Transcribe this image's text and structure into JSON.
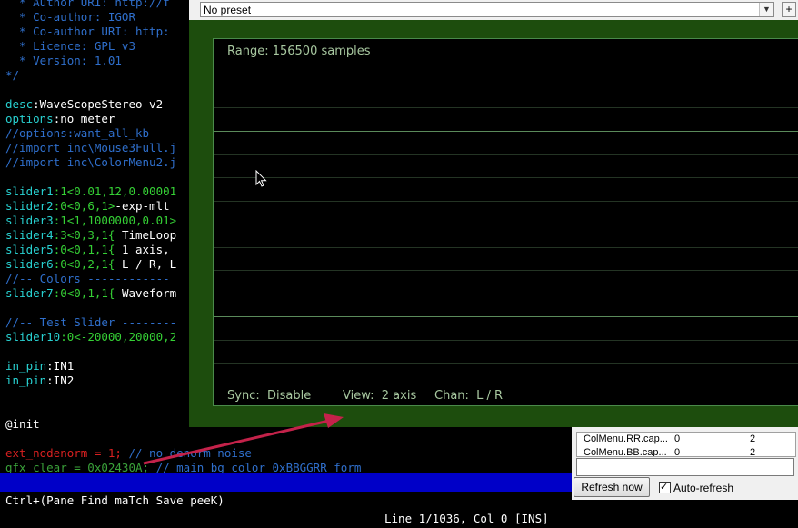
{
  "editor": {
    "lines": [
      [
        {
          "t": "  * Author URI: http://f",
          "c": "c"
        }
      ],
      [
        {
          "t": "  * Co-author: IGOR",
          "c": "c"
        }
      ],
      [
        {
          "t": "  * Co-author URI: http:",
          "c": "c"
        }
      ],
      [
        {
          "t": "  * Licence: GPL v3",
          "c": "c"
        }
      ],
      [
        {
          "t": "  * Version: 1.01",
          "c": "c"
        }
      ],
      [
        {
          "t": "*/",
          "c": "c"
        }
      ],
      [
        {
          "t": "",
          "c": "w"
        }
      ],
      [
        {
          "t": "desc",
          "c": "cy"
        },
        {
          "t": ":WaveScopeStereo v2",
          "c": "w"
        }
      ],
      [
        {
          "t": "options",
          "c": "cy"
        },
        {
          "t": ":no_meter",
          "c": "w"
        }
      ],
      [
        {
          "t": "//options:want_all_kb",
          "c": "c"
        }
      ],
      [
        {
          "t": "//import inc\\Mouse3Full.j",
          "c": "c"
        }
      ],
      [
        {
          "t": "//import inc\\ColorMenu2.j",
          "c": "c"
        }
      ],
      [
        {
          "t": "",
          "c": "w"
        }
      ],
      [
        {
          "t": "slider1",
          "c": "cy"
        },
        {
          "t": ":1<0.01,12,0.00001",
          "c": "g"
        }
      ],
      [
        {
          "t": "slider2",
          "c": "cy"
        },
        {
          "t": ":0<0,6,1>",
          "c": "g"
        },
        {
          "t": "-exp-mlt",
          "c": "w"
        }
      ],
      [
        {
          "t": "slider3",
          "c": "cy"
        },
        {
          "t": ":1<1,1000000,0.01>",
          "c": "g"
        }
      ],
      [
        {
          "t": "slider4",
          "c": "cy"
        },
        {
          "t": ":3<0,3,1{",
          "c": "g"
        },
        {
          "t": " TimeLoop",
          "c": "w"
        }
      ],
      [
        {
          "t": "slider5",
          "c": "cy"
        },
        {
          "t": ":0<0,1,1{",
          "c": "g"
        },
        {
          "t": " 1 axis,",
          "c": "w"
        }
      ],
      [
        {
          "t": "slider6",
          "c": "cy"
        },
        {
          "t": ":0<0,2,1{",
          "c": "g"
        },
        {
          "t": " L / R, L",
          "c": "w"
        }
      ],
      [
        {
          "t": "//-- Colors ------------",
          "c": "c"
        }
      ],
      [
        {
          "t": "slider7",
          "c": "cy"
        },
        {
          "t": ":0<0,1,1{",
          "c": "g"
        },
        {
          "t": " Waveform",
          "c": "w"
        }
      ],
      [
        {
          "t": "",
          "c": "w"
        }
      ],
      [
        {
          "t": "//-- Test Slider --------",
          "c": "c"
        }
      ],
      [
        {
          "t": "slider10",
          "c": "cy"
        },
        {
          "t": ":0<-20000,20000,2",
          "c": "g"
        }
      ],
      [
        {
          "t": "",
          "c": "w"
        }
      ],
      [
        {
          "t": "in_pin",
          "c": "cy"
        },
        {
          "t": ":IN1",
          "c": "w"
        }
      ],
      [
        {
          "t": "in_pin",
          "c": "cy"
        },
        {
          "t": ":IN2",
          "c": "w"
        }
      ],
      [
        {
          "t": "",
          "c": "w"
        }
      ],
      [
        {
          "t": "",
          "c": "w"
        }
      ],
      [
        {
          "t": "@init",
          "c": "w"
        }
      ],
      [
        {
          "t": "",
          "c": "w"
        }
      ],
      [
        {
          "t": "ext_nodenorm = 1; ",
          "c": "r"
        },
        {
          "t": "// no denorm noise",
          "c": "c"
        }
      ],
      [
        {
          "t": "gfx_clear = 0x02430A; ",
          "c": "gr"
        },
        {
          "t": "// main bg color 0xBBGGRR form",
          "c": "c"
        }
      ]
    ]
  },
  "statusbar": {
    "left": "Ctrl+(Pane Find maTch Save peeK)",
    "right": "Line 1/1036, Col 0 [INS]"
  },
  "sidepanel": {
    "rows": [
      {
        "name": "ColMenu.RR.cap...",
        "a": "0",
        "b": "2"
      },
      {
        "name": "ColMenu.BB.cap...",
        "a": "0",
        "b": "2"
      }
    ],
    "refresh_label": "Refresh now",
    "autorefresh_label": "Auto-refresh",
    "autorefresh_checked": true
  },
  "plugin": {
    "preset_value": "No preset",
    "plus_label": "+",
    "range_text": "Range: 156500 samples",
    "sync_text": "Sync:  Disable",
    "view_text": "View:  2 axis",
    "chan_text": "Chan:  L / R",
    "background_color": "#1d4d0d"
  },
  "icons": [
    "chevron-down-icon",
    "mouse-cursor-icon",
    "annotation-arrow-icon",
    "checkmark-icon"
  ]
}
